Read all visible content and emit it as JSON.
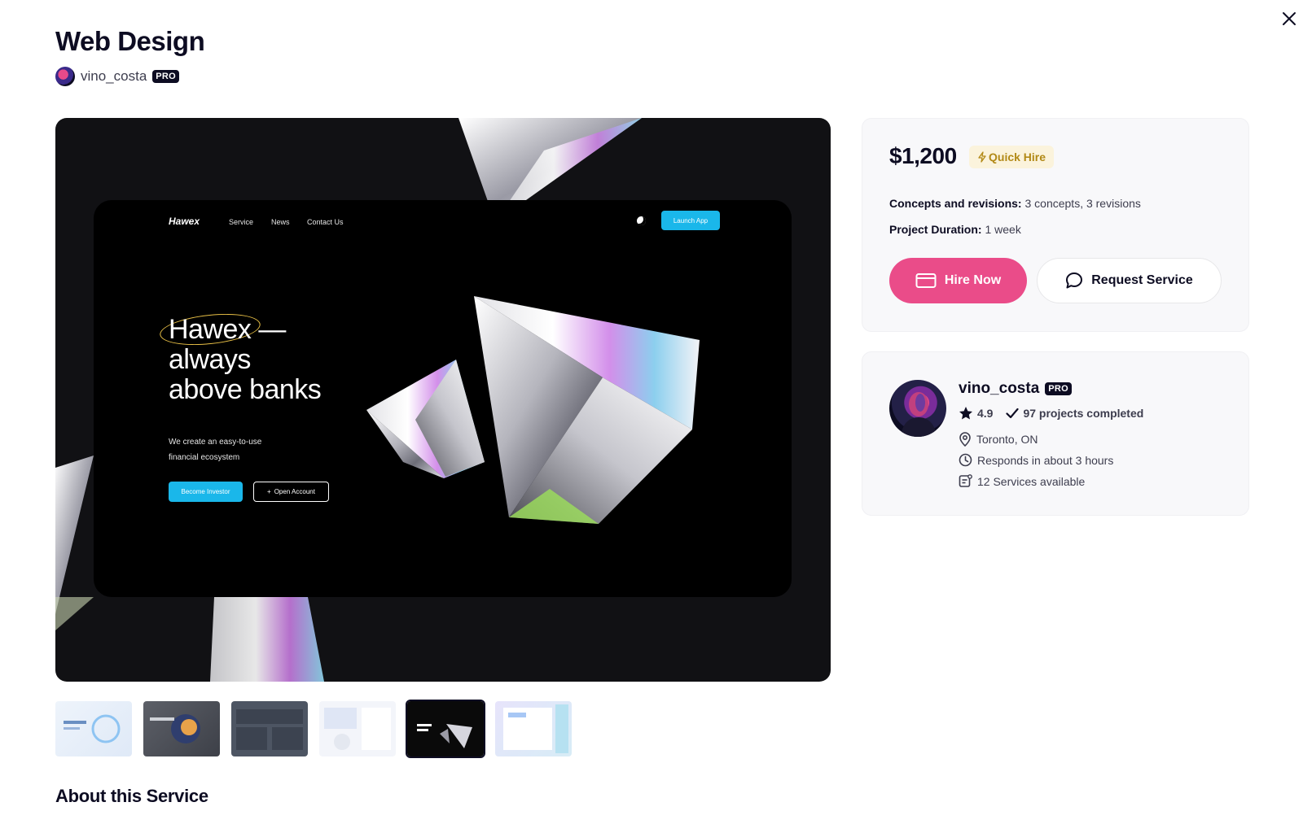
{
  "header": {
    "title": "Web Design",
    "author": "vino_costa",
    "pro_badge": "PRO"
  },
  "hero_mockup": {
    "logo": "Hawex",
    "nav_links": [
      "Service",
      "News",
      "Contact Us"
    ],
    "launch_button": "Launch App",
    "headline_line1": "Hawex —",
    "headline_line2": "always",
    "headline_line3": "above banks",
    "subtext": "We create an easy-to-use financial ecosystem",
    "primary_button": "Become Investor",
    "secondary_button": "Open Account"
  },
  "thumbnails": {
    "count": 6,
    "selected_index": 4
  },
  "about": {
    "title": "About this Service"
  },
  "pricing": {
    "price": "$1,200",
    "quick_hire_label": "Quick Hire",
    "concepts_label": "Concepts and revisions:",
    "concepts_value": "3 concepts, 3 revisions",
    "duration_label": "Project Duration:",
    "duration_value": "1 week",
    "hire_button": "Hire Now",
    "request_button": "Request Service"
  },
  "profile": {
    "name": "vino_costa",
    "pro_badge": "PRO",
    "rating": "4.9",
    "projects": "97 projects completed",
    "location": "Toronto, ON",
    "response_time": "Responds in about 3 hours",
    "services": "12 Services available"
  },
  "colors": {
    "accent_pink": "#ea4c89",
    "quick_hire_bg": "#fbf3dc",
    "quick_hire_text": "#b28916",
    "mockup_cyan": "#1ab7ea"
  },
  "icons": {
    "close": "close-icon",
    "quick_hire": "lightning-icon",
    "hire": "credit-card-icon",
    "request": "chat-bubble-icon",
    "rating": "star-icon",
    "projects": "checkmark-icon",
    "location": "location-pin-icon",
    "response": "clock-icon",
    "services": "services-list-icon"
  }
}
